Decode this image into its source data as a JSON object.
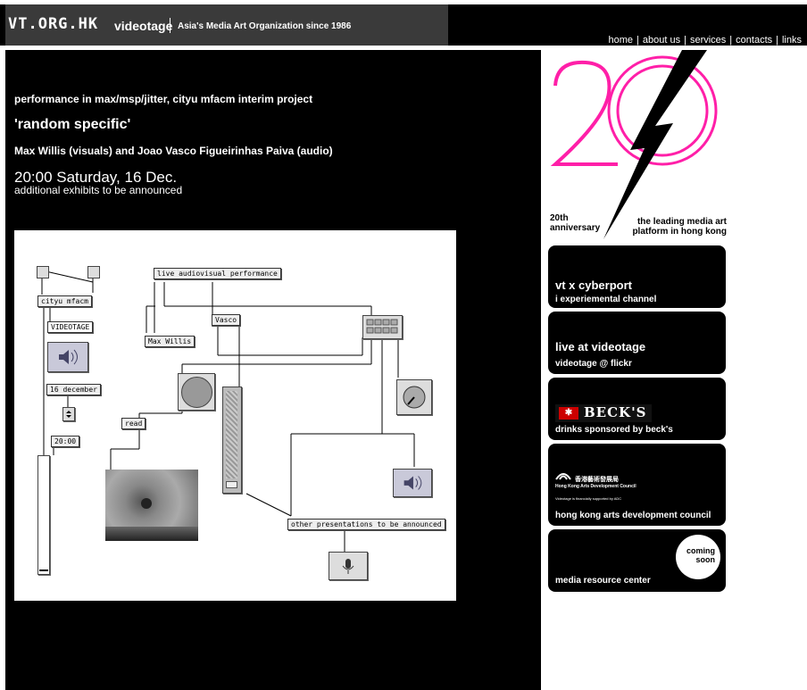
{
  "header": {
    "logo": "VT.ORG.HK",
    "brand": "videotage",
    "tagline": "Asia's Media Art Organization since 1986",
    "nav": [
      "home",
      "about us",
      "services",
      "contacts",
      "links"
    ]
  },
  "event": {
    "project": "performance in max/msp/jitter, cityu mfacm interim project",
    "title": "'random specific'",
    "artists": "Max Willis (visuals) and Joao Vasco Figueirinhas Paiva (audio)",
    "time": "20:00 Saturday, 16 Dec.",
    "extra": "additional exhibits to be announced"
  },
  "patch": {
    "cityu": "cityu mfacm",
    "videotage": "VIDEOTAGE",
    "date": "16 december",
    "time": "20:00",
    "live": "live audiovisual performance",
    "vasco": "Vasco",
    "max": "Max Willis",
    "read": "read",
    "other": "other presentations to be announced"
  },
  "sidebar": {
    "anniv_left": [
      "20th",
      "anniversary"
    ],
    "anniv_right": [
      "the leading media art",
      "platform in hong kong"
    ],
    "colors": {
      "accent": "#ff1fa8"
    },
    "cards": [
      {
        "title": "vt x cyberport",
        "sub": "i experiemental channel"
      },
      {
        "title": "live at videotage",
        "sub": "videotage @ flickr"
      },
      {
        "logo": "BECK'S",
        "sub": "drinks sponsored by beck's"
      },
      {
        "logo_cn": "香港藝術發展局",
        "logo_en": "Hong Kong Arts Development Council",
        "logo_note": "Videotage is financially supported by ADC",
        "sub": "hong kong arts development council"
      },
      {
        "badge": [
          "coming",
          "soon"
        ],
        "sub": "media resource center"
      }
    ]
  }
}
